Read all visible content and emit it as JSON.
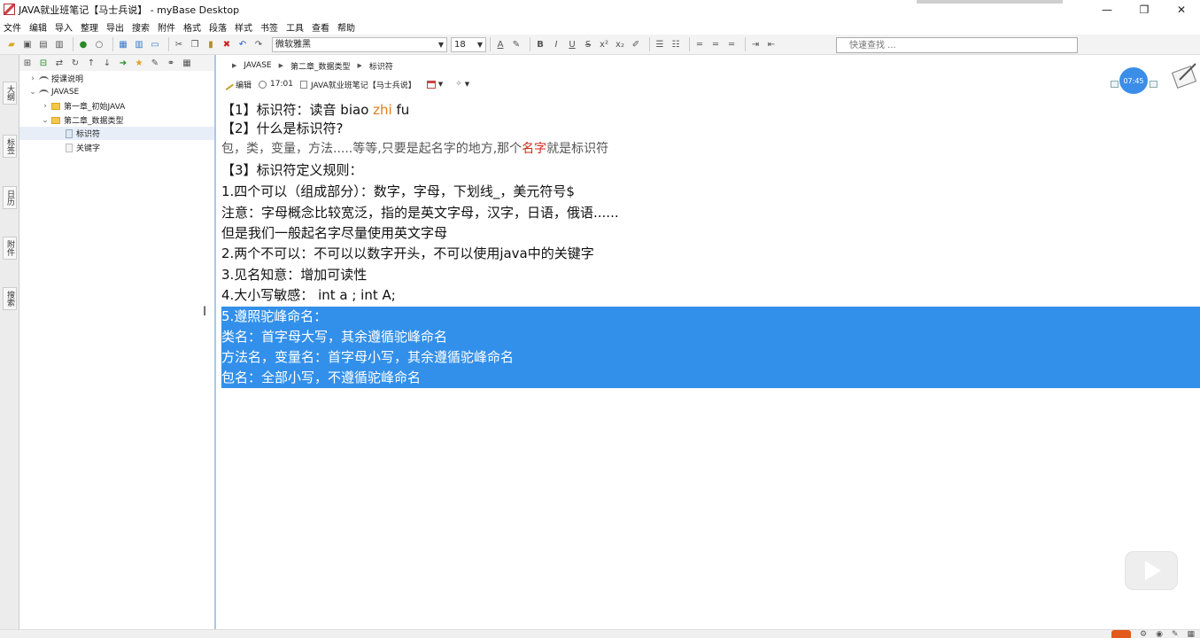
{
  "window": {
    "title": "JAVA就业班笔记【马士兵说】 - myBase Desktop",
    "minimize": "—",
    "maximize": "❐",
    "close": "✕"
  },
  "menu": [
    "文件",
    "编辑",
    "导入",
    "整理",
    "导出",
    "搜索",
    "附件",
    "格式",
    "段落",
    "样式",
    "书签",
    "工具",
    "查看",
    "帮助"
  ],
  "toolbar": {
    "font_family": "微软雅黑",
    "font_size": "18",
    "search_placeholder": "快速查找 ..."
  },
  "side_tabs": [
    "大纲",
    "标签",
    "日历",
    "附件",
    "搜索"
  ],
  "tree": [
    {
      "label": "授课说明",
      "level": 1,
      "type": "book",
      "expanded": false
    },
    {
      "label": "JAVASE",
      "level": 1,
      "type": "book",
      "expanded": true
    },
    {
      "label": "第一章_初始JAVA",
      "level": 2,
      "type": "folder",
      "expanded": false
    },
    {
      "label": "第二章_数据类型",
      "level": 2,
      "type": "folder",
      "expanded": true
    },
    {
      "label": "标识符",
      "level": 3,
      "type": "doc",
      "selected": true
    },
    {
      "label": "关键字",
      "level": 3,
      "type": "doc",
      "selected": false
    }
  ],
  "breadcrumb": [
    "JAVASE",
    "第二章_数据类型",
    "标识符"
  ],
  "info": {
    "edit_label": "编辑",
    "time": "17:01",
    "notebook": "JAVA就业班笔记【马士兵说】"
  },
  "badge_time": "07:45",
  "content": {
    "l1_a": "【1】标识符：读音   biao ",
    "l1_b": "zhi",
    "l1_c": " fu",
    "l2": "【2】什么是标识符?",
    "l3_a": "  包，类，变量，方法.....等等,只要是起名字的地方,那个",
    "l3_b": "名字",
    "l3_c": "就是标识符",
    "l4": "【3】标识符定义规则：",
    "l5": "1.四个可以（组成部分）：数字，字母，下划线_，美元符号$",
    "l6": "注意：字母概念比较宽泛，指的是英文字母，汉字，日语，俄语......",
    "l7": "但是我们一般起名字尽量使用英文字母",
    "l8": "2.两个不可以：不可以以数字开头，不可以使用java中的关键字",
    "l9": "3.见名知意：增加可读性",
    "l10": "4.大小写敏感：   int a ; int A;",
    "l11": "5.遵照驼峰命名：",
    "l12": " 类名：首字母大写，其余遵循驼峰命名",
    "l13": " 方法名，变量名：首字母小写，其余遵循驼峰命名",
    "l14": " 包名：全部小写，不遵循驼峰命名"
  },
  "colors": {
    "selection": "#3390ea",
    "orange_text": "#e07b1a",
    "red_text": "#d0281c",
    "badge": "#3b8ee8"
  }
}
